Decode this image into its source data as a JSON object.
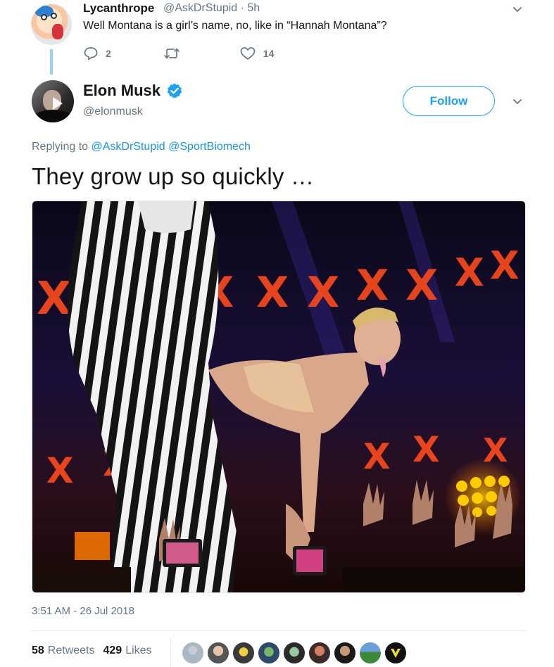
{
  "reply": {
    "name": "Lycanthrope",
    "handle_time": "@AskDrStupid · 5h",
    "text": "Well Montana is a girl’s name, no, like in “Hannah Montana”?",
    "replies": "2",
    "retweets": "",
    "likes": "14"
  },
  "tweet": {
    "name": "Elon Musk",
    "handle": "@elonmusk",
    "follow_label": "Follow",
    "replying_prefix": "Replying to",
    "mention_1": "@AskDrStupid",
    "mention_2": "@SportBiomech",
    "text": "They grow up so quickly …",
    "timestamp": "3:51 AM - 26 Jul 2018",
    "retweets_count": "58",
    "retweets_label": "Retweets",
    "likes_count": "429",
    "likes_label": "Likes"
  },
  "colors": {
    "accent": "#1da1f2",
    "link": "#1b95e0",
    "muted": "#657786"
  },
  "icons": {
    "reply": "speech-bubble-icon",
    "retweet": "retweet-icon",
    "like": "heart-icon",
    "verified": "verified-badge-icon",
    "more": "chevron-down-icon"
  }
}
